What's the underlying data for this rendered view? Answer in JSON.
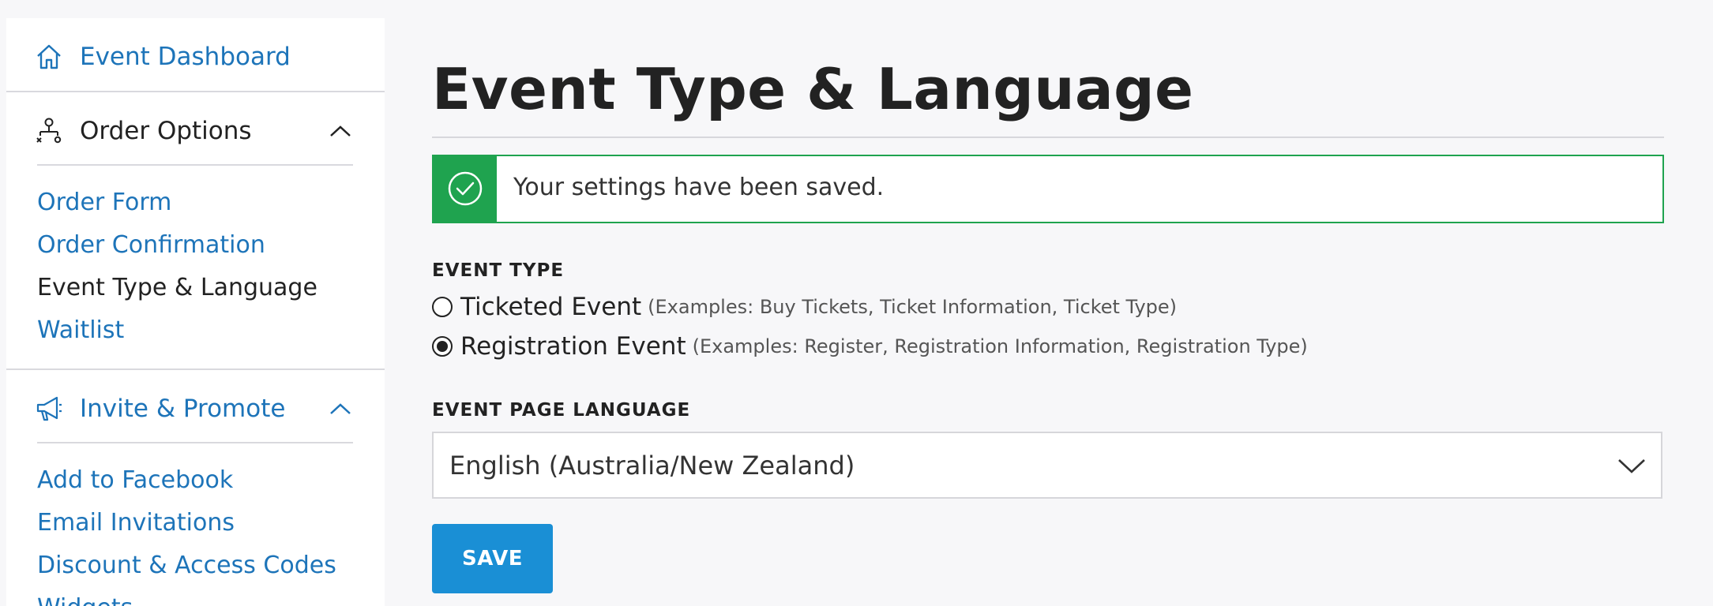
{
  "sidebar": {
    "dashboard": {
      "label": "Event Dashboard",
      "icon": "home-icon"
    },
    "order_options": {
      "label": "Order Options",
      "icon": "org-chart-icon",
      "expanded": true,
      "items": [
        {
          "label": "Order Form",
          "active": false
        },
        {
          "label": "Order Confirmation",
          "active": false
        },
        {
          "label": "Event Type & Language",
          "active": true
        },
        {
          "label": "Waitlist",
          "active": false
        }
      ]
    },
    "invite_promote": {
      "label": "Invite & Promote",
      "icon": "megaphone-icon",
      "expanded": true,
      "items": [
        {
          "label": "Add to Facebook"
        },
        {
          "label": "Email Invitations"
        },
        {
          "label": "Discount & Access Codes"
        },
        {
          "label": "Widgets"
        }
      ]
    }
  },
  "main": {
    "title": "Event Type & Language",
    "alert": {
      "message": "Your settings have been saved.",
      "icon": "check-circle-icon"
    },
    "event_type": {
      "label": "EVENT TYPE",
      "options": [
        {
          "label": "Ticketed Event",
          "hint": "(Examples: Buy Tickets, Ticket Information, Ticket Type)",
          "checked": false
        },
        {
          "label": "Registration Event",
          "hint": "(Examples: Register, Registration Information, Registration Type)",
          "checked": true
        }
      ]
    },
    "language": {
      "label": "EVENT PAGE LANGUAGE",
      "selected": "English (Australia/New Zealand)"
    },
    "save_label": "SAVE"
  },
  "colors": {
    "link_blue": "#1d74b9",
    "success_green": "#1fa34f",
    "button_blue": "#1a8fd5",
    "page_bg": "#f7f7f9"
  }
}
